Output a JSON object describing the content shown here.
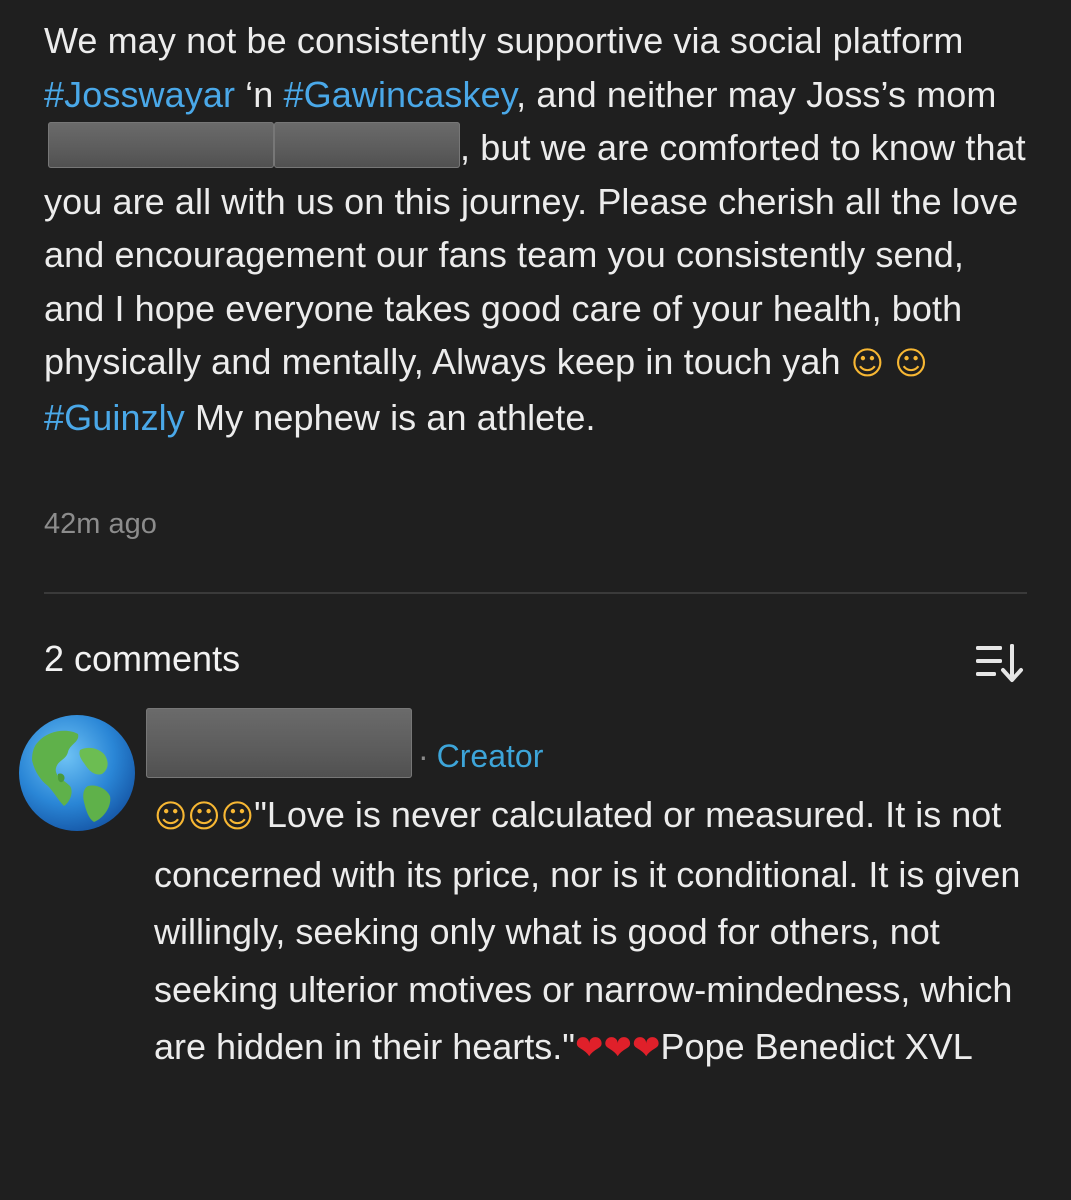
{
  "post": {
    "text_1": "We may not be consistently supportive via social platform ",
    "hashtag_1": "#Josswayar",
    "text_2": " ‘n ",
    "hashtag_2": "#Gawincaskey",
    "text_3": ", and neither may Joss’s mom",
    "text_4": ", but we are comforted to know that you are all with us on this journey. Please cherish all the love and encouragement our fans team you consistently send, and I hope everyone takes good care of your health, both physically and mentally, Always keep in touch yah ",
    "emoji_1": "☺",
    "emoji_2": "☺",
    "hashtag_3": "#Guinzly",
    "text_5": " My nephew is an athlete.",
    "timestamp": "42m ago"
  },
  "comments": {
    "header": "2 comments",
    "items": [
      {
        "role_label": "Creator",
        "separator": "·",
        "emoji_prefix": [
          "☺",
          "☺",
          "☺"
        ],
        "text": "\"Love is never calculated or measured. It is not concerned with its price, nor is it conditional. It is given willingly, seeking only what is good for others, not seeking ulterior motives or narrow-mindedness, which are hidden in their hearts.\"",
        "heart_emojis": [
          "❤",
          "❤",
          "❤"
        ],
        "text_suffix": "Pope Benedict XVL"
      }
    ]
  },
  "icons": {
    "sort": "sort-icon",
    "avatar": "earth-globe-icon"
  },
  "colors": {
    "background": "#1f1f1f",
    "hashtag": "#4aa8e8",
    "creator": "#3da5d9",
    "muted": "#8c8c8c"
  }
}
